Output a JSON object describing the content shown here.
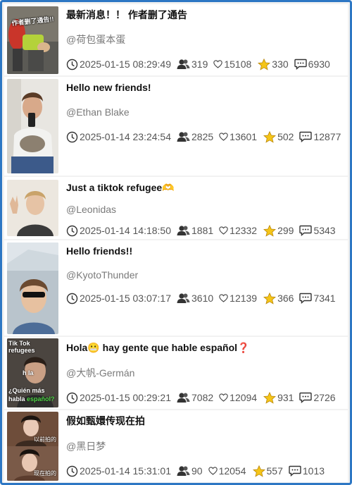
{
  "posts": [
    {
      "title": "最新消息！！ 作者删了通告",
      "author": "@荷包蛋本蛋",
      "date": "2025-01-15 08:29:49",
      "views": "319",
      "likes": "15108",
      "favorites": "330",
      "comments": "6930",
      "thumb_text": "作者删了通告!!"
    },
    {
      "title": "Hello new friends!",
      "author": "@Ethan Blake",
      "date": "2025-01-14 23:24:54",
      "views": "2825",
      "likes": "13601",
      "favorites": "502",
      "comments": "12877"
    },
    {
      "title": "Just a tiktok refugee🫶",
      "author": "@Leonidas",
      "date": "2025-01-14 14:18:50",
      "views": "1881",
      "likes": "12332",
      "favorites": "299",
      "comments": "5343"
    },
    {
      "title": "Hello friends!!",
      "author": "@KyotoThunder",
      "date": "2025-01-15 03:07:17",
      "views": "3610",
      "likes": "12139",
      "favorites": "366",
      "comments": "7341"
    },
    {
      "title": "Hola😬 hay gente que hable español❓",
      "author": "@大帆-Germán",
      "date": "2025-01-15 00:29:21",
      "views": "7082",
      "likes": "12094",
      "favorites": "931",
      "comments": "2726",
      "thumb_text_top": "Tik Tok refugees",
      "thumb_text_mid": "h  la",
      "thumb_text_bottom": "¿Quién más habla",
      "thumb_text_accent": "español?"
    },
    {
      "title": "假如甄嬛传现在拍",
      "author": "@黑日梦",
      "date": "2025-01-14 15:31:01",
      "views": "90",
      "likes": "12054",
      "favorites": "557",
      "comments": "1013",
      "thumb_caption_1": "以前拍的",
      "thumb_caption_2": "现在拍的"
    }
  ],
  "colors": {
    "frame": "#2d77c4",
    "star": "#f5c518"
  },
  "icons": [
    "clock-icon",
    "views-icon",
    "heart-icon",
    "star-icon",
    "comment-icon"
  ]
}
